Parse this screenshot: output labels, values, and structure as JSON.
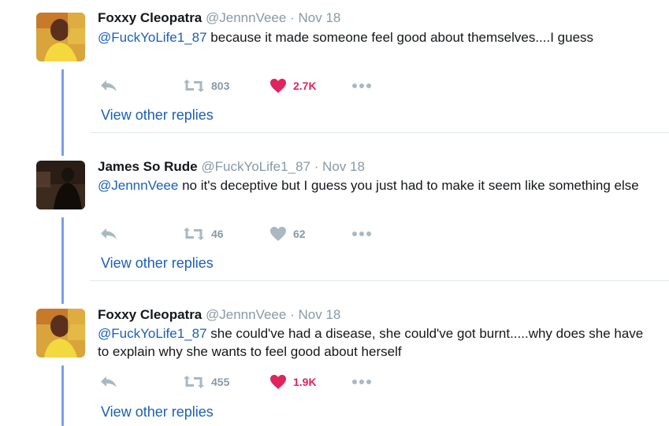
{
  "tweets": [
    {
      "name": "Foxxy Cleopatra",
      "handle": "@JennnVeee",
      "dot": "·",
      "date": "Nov 18",
      "mention": "@FuckYoLife1_87",
      "text": " because it made someone feel good about themselves....I guess",
      "retweets": "803",
      "likes": "2.7K",
      "liked": true,
      "view_replies": "View other replies"
    },
    {
      "name": "James So Rude",
      "handle": "@FuckYoLife1_87",
      "dot": "·",
      "date": "Nov 18",
      "mention": "@JennnVeee",
      "text": " no it's deceptive but I guess you just had to make it seem like something else",
      "retweets": "46",
      "likes": "62",
      "liked": false,
      "view_replies": "View other replies"
    },
    {
      "name": "Foxxy Cleopatra",
      "handle": "@JennnVeee",
      "dot": "·",
      "date": "Nov 18",
      "mention": "@FuckYoLife1_87",
      "text": " she could've had a disease, she could've got burnt.....why does she have to explain why she wants to feel good about herself",
      "retweets": "455",
      "likes": "1.9K",
      "liked": true,
      "view_replies": "View other replies"
    }
  ],
  "colors": {
    "accent_link": "#1b5fb8",
    "like_active": "#e0245e",
    "icon_gray": "#aab8c2",
    "thread_line": "#7a9ee6"
  },
  "icons": [
    "reply-icon",
    "retweet-icon",
    "heart-icon",
    "more-icon"
  ]
}
